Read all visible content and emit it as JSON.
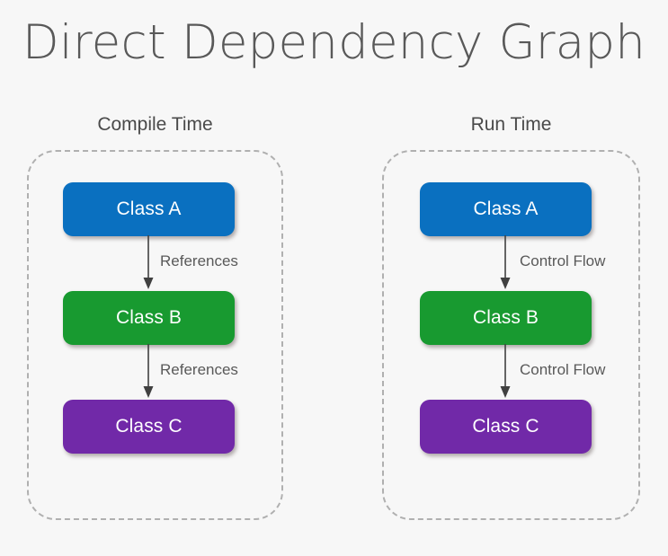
{
  "title": "Direct Dependency Graph",
  "background_color": "#f7f7f7",
  "title_color": "#595959",
  "panels": [
    {
      "id": "compile-time",
      "label": "Compile Time",
      "nodes": [
        {
          "id": "class-a",
          "label": "Class A",
          "color": "#0A70C0"
        },
        {
          "id": "class-b",
          "label": "Class B",
          "color": "#189A30"
        },
        {
          "id": "class-c",
          "label": "Class C",
          "color": "#7129A8"
        }
      ],
      "edges": [
        {
          "from": "class-a",
          "to": "class-b",
          "label": "References"
        },
        {
          "from": "class-b",
          "to": "class-c",
          "label": "References"
        }
      ]
    },
    {
      "id": "run-time",
      "label": "Run Time",
      "nodes": [
        {
          "id": "class-a",
          "label": "Class A",
          "color": "#0A70C0"
        },
        {
          "id": "class-b",
          "label": "Class B",
          "color": "#189A30"
        },
        {
          "id": "class-c",
          "label": "Class C",
          "color": "#7129A8"
        }
      ],
      "edges": [
        {
          "from": "class-a",
          "to": "class-b",
          "label": "Control Flow"
        },
        {
          "from": "class-b",
          "to": "class-c",
          "label": "Control Flow"
        }
      ]
    }
  ],
  "edge_label_color": "#595959",
  "panel_border_color": "#b0b0b0",
  "arrow_color": "#404040"
}
